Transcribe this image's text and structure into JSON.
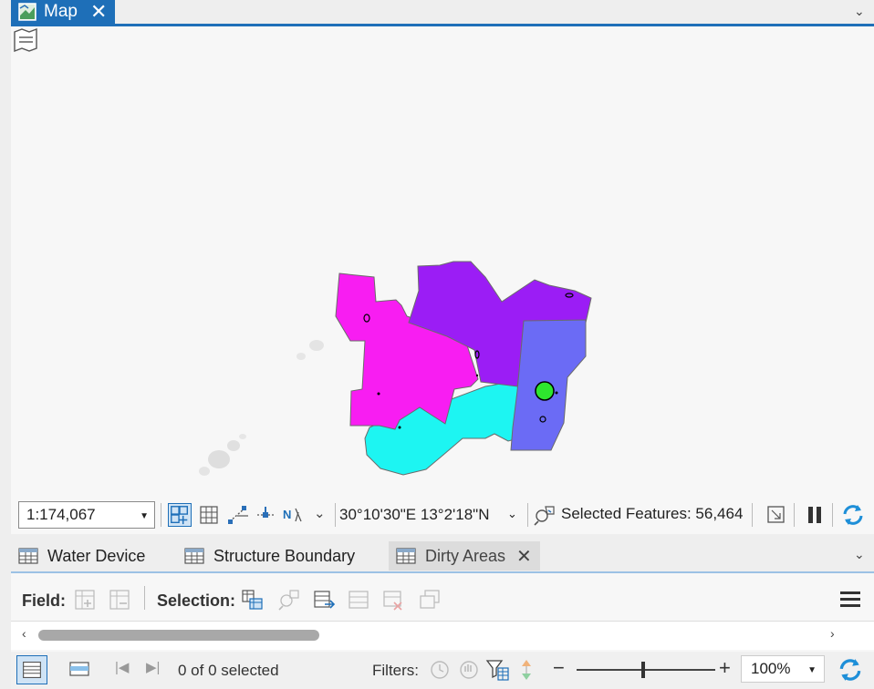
{
  "map_tab": {
    "label": "Map",
    "close_icon": "close-icon",
    "color": "#1e6fb8"
  },
  "map": {
    "polygons": [
      {
        "name": "magenta-area",
        "color": "#f81df2"
      },
      {
        "name": "purple-area",
        "color": "#9b1df5"
      },
      {
        "name": "periwinkle-area",
        "color": "#6b6bf5"
      },
      {
        "name": "cyan-area",
        "color": "#1df5f2"
      }
    ],
    "point_color": "#2ee62e"
  },
  "status_bar": {
    "scale": "1:174,067",
    "coordinates": "30°10'30\"E 13°2'18\"N",
    "selected_features": "Selected Features: 56,464"
  },
  "table_tabs": [
    {
      "label": "Water Device"
    },
    {
      "label": "Structure Boundary"
    },
    {
      "label": "Dirty Areas",
      "active": true
    }
  ],
  "toolbar": {
    "field_label": "Field:",
    "selection_label": "Selection:"
  },
  "bottom_bar": {
    "selection_count": "0 of 0 selected",
    "filters_label": "Filters:",
    "zoom": "100%"
  }
}
